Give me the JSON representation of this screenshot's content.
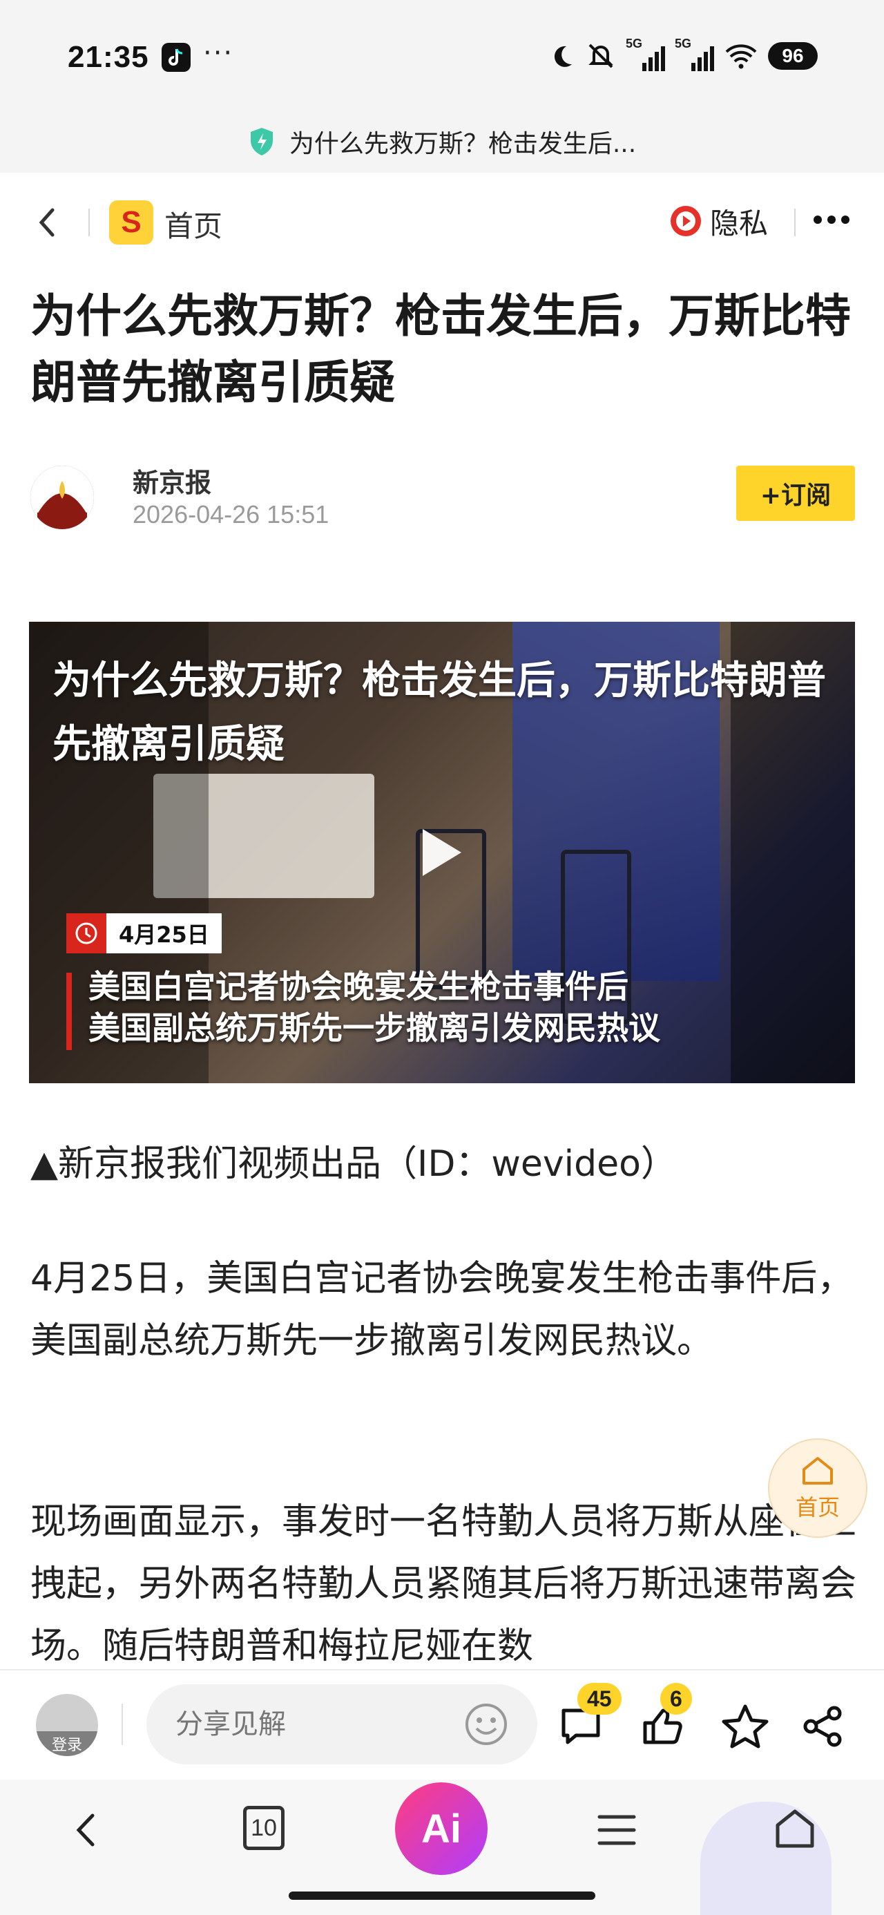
{
  "status_bar": {
    "time": "21:35",
    "more_dots": "···",
    "signal_1": "5G",
    "signal_2": "5G",
    "battery": "96"
  },
  "address_bar": {
    "page_title": "为什么先救万斯？枪击发生后..."
  },
  "nav": {
    "site_logo_letter": "S",
    "home_label": "首页",
    "privacy_label": "隐私"
  },
  "article": {
    "title": "为什么先救万斯？枪击发生后，万斯比特朗普先撤离引质疑",
    "author": "新京报",
    "publish_time": "2026-04-26 15:51",
    "subscribe_label": "+订阅",
    "video": {
      "title": "为什么先救万斯？枪击发生后，万斯比特朗普先撤离引质疑",
      "date_badge": "4月25日",
      "caption_line1": "美国白宫记者协会晚宴发生枪击事件后",
      "caption_line2": "美国副总统万斯先一步撤离引发网民热议"
    },
    "paragraphs": [
      "▲新京报我们视频出品（ID：wevideo）",
      "4月25日，美国白宫记者协会晚宴发生枪击事件后，美国副总统万斯先一步撤离引发网民热议。",
      "现场画面显示，事发时一名特勤人员将万斯从座位上拽起，另外两名特勤人员紧随其后将万斯迅速带离会场。随后特朗普和梅拉尼娅在数"
    ]
  },
  "float_home": {
    "label": "首页"
  },
  "comment_bar": {
    "login_label": "登录",
    "input_placeholder": "分享见解",
    "comment_count": "45",
    "like_count": "6"
  },
  "browser_bar": {
    "tabs_count": "10",
    "ai_label": "Ai"
  },
  "colors": {
    "accent_yellow": "#ffd42a",
    "brand_red": "#d8261c",
    "ai_gradient_start": "#ff3d7f",
    "ai_gradient_end": "#b03dff"
  },
  "icons": [
    "tiktok-icon",
    "moon-icon",
    "mute-icon",
    "signal-icon",
    "wifi-icon",
    "shield-icon",
    "back-icon",
    "privacy-play-icon",
    "more-icon",
    "play-icon",
    "clock-icon",
    "home-icon",
    "emoji-icon",
    "comment-icon",
    "like-icon",
    "star-icon",
    "share-icon",
    "menu-icon",
    "tabs-icon"
  ]
}
